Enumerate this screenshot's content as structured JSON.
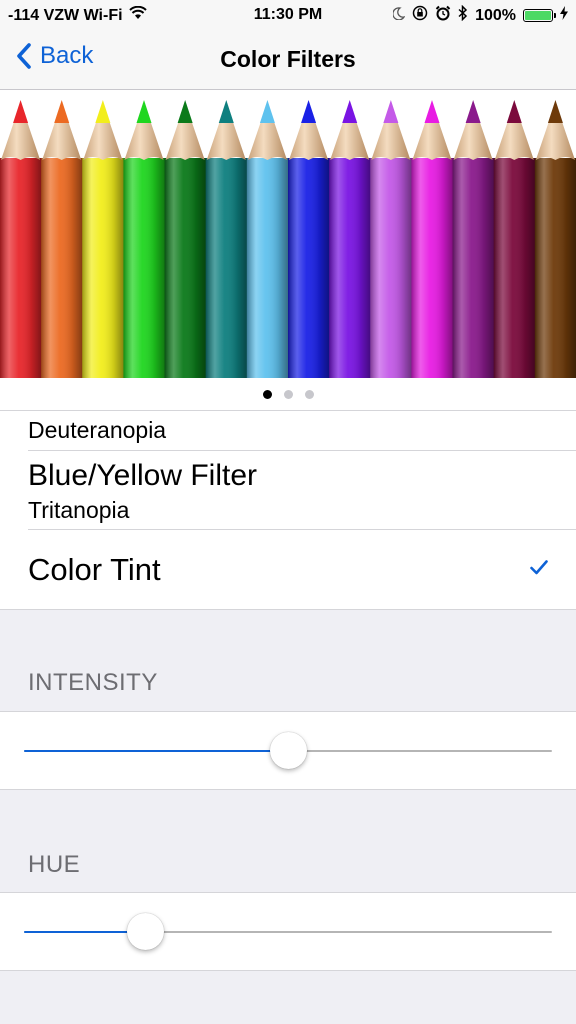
{
  "status_bar": {
    "carrier": "-114 VZW Wi-Fi",
    "time": "11:30 PM",
    "battery": "100%",
    "icons": [
      "wifi-icon",
      "moon-icon",
      "rotation-lock-icon",
      "alarm-icon",
      "bluetooth-icon",
      "battery-icon",
      "charging-icon"
    ]
  },
  "nav": {
    "back_label": "Back",
    "title": "Color Filters"
  },
  "preview": {
    "pencil_colors": [
      "#e8262b",
      "#ec6a22",
      "#f2ee1c",
      "#1fd61f",
      "#0b7a1a",
      "#0e7f7f",
      "#5fc2ee",
      "#1a21e6",
      "#7a14e3",
      "#c45ae8",
      "#e81ce3",
      "#8a1a8c",
      "#7b0a3c",
      "#6e3a0a"
    ],
    "page_count": 3,
    "current_page": 1
  },
  "filters": {
    "partial_row_subtitle": "Deuteranopia",
    "blue_yellow": {
      "title": "Blue/Yellow Filter",
      "subtitle": "Tritanopia"
    },
    "color_tint": {
      "title": "Color Tint",
      "selected": true
    }
  },
  "intensity": {
    "header": "INTENSITY",
    "value": 0.5
  },
  "hue": {
    "header": "HUE",
    "value": 0.23
  },
  "colors": {
    "accent": "#0e62d6",
    "background": "#efeff4",
    "section_text": "#6d6d72"
  }
}
